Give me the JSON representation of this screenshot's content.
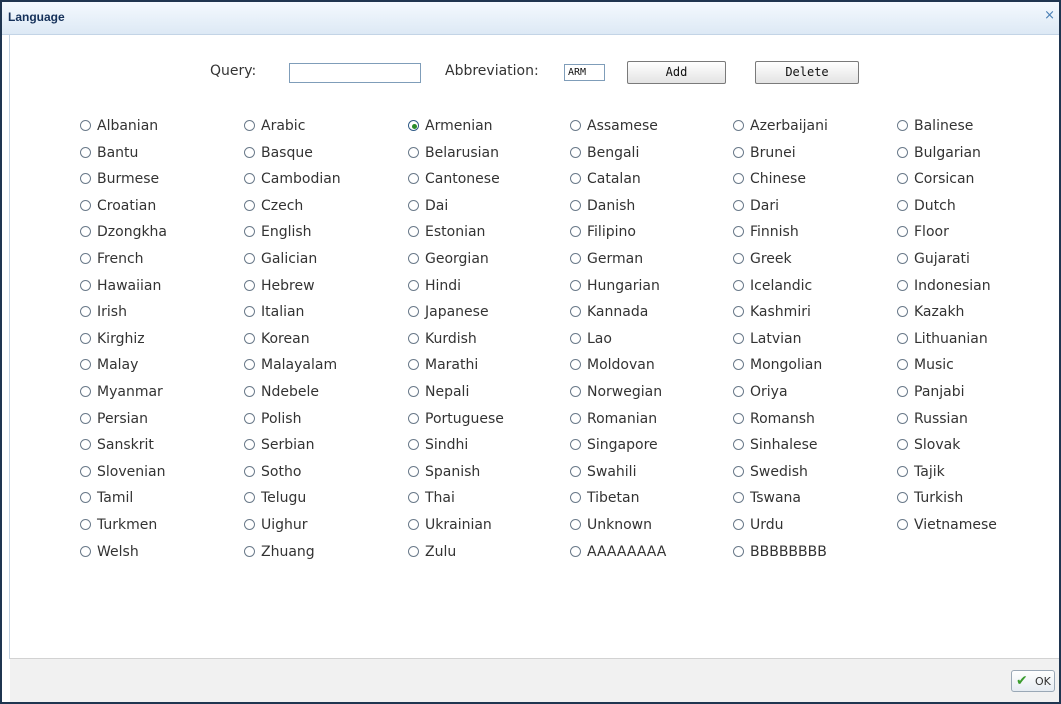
{
  "window": {
    "title": "Language",
    "close_glyph": "×"
  },
  "toolbar": {
    "query_label": "Query:",
    "query_value": "",
    "abbreviation_label": "Abbreviation:",
    "abbreviation_value": "ARM",
    "add_label": "Add",
    "delete_label": "Delete"
  },
  "languages": [
    [
      "Albanian",
      "Arabic",
      "Armenian",
      "Assamese",
      "Azerbaijani",
      "Balinese"
    ],
    [
      "Bantu",
      "Basque",
      "Belarusian",
      "Bengali",
      "Brunei",
      "Bulgarian"
    ],
    [
      "Burmese",
      "Cambodian",
      "Cantonese",
      "Catalan",
      "Chinese",
      "Corsican"
    ],
    [
      "Croatian",
      "Czech",
      "Dai",
      "Danish",
      "Dari",
      "Dutch"
    ],
    [
      "Dzongkha",
      "English",
      "Estonian",
      "Filipino",
      "Finnish",
      "Floor"
    ],
    [
      "French",
      "Galician",
      "Georgian",
      "German",
      "Greek",
      "Gujarati"
    ],
    [
      "Hawaiian",
      "Hebrew",
      "Hindi",
      "Hungarian",
      "Icelandic",
      "Indonesian"
    ],
    [
      "Irish",
      "Italian",
      "Japanese",
      "Kannada",
      "Kashmiri",
      "Kazakh"
    ],
    [
      "Kirghiz",
      "Korean",
      "Kurdish",
      "Lao",
      "Latvian",
      "Lithuanian"
    ],
    [
      "Malay",
      "Malayalam",
      "Marathi",
      "Moldovan",
      "Mongolian",
      "Music"
    ],
    [
      "Myanmar",
      "Ndebele",
      "Nepali",
      "Norwegian",
      "Oriya",
      "Panjabi"
    ],
    [
      "Persian",
      "Polish",
      "Portuguese",
      "Romanian",
      "Romansh",
      "Russian"
    ],
    [
      "Sanskrit",
      "Serbian",
      "Sindhi",
      "Singapore",
      "Sinhalese",
      "Slovak"
    ],
    [
      "Slovenian",
      "Sotho",
      "Spanish",
      "Swahili",
      "Swedish",
      "Tajik"
    ],
    [
      "Tamil",
      "Telugu",
      "Thai",
      "Tibetan",
      "Tswana",
      "Turkish"
    ],
    [
      "Turkmen",
      "Uighur",
      "Ukrainian",
      "Unknown",
      "Urdu",
      "Vietnamese"
    ],
    [
      "Welsh",
      "Zhuang",
      "Zulu",
      "AAAAAAAA",
      "BBBBBBBB"
    ]
  ],
  "selected_language": "Armenian",
  "footer": {
    "ok_label": "OK",
    "ok_icon": "checkmark-icon"
  },
  "colors": {
    "title_text": "#15315a",
    "selected_dot": "#2a8c2a",
    "ok_check": "#3a9c2e"
  }
}
